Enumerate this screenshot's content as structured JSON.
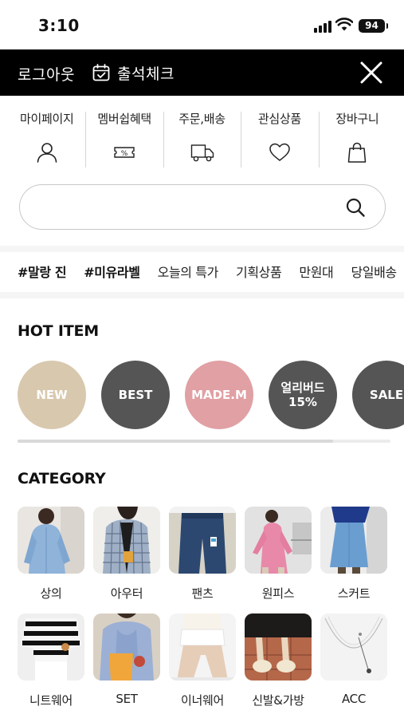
{
  "status": {
    "time": "3:10",
    "battery": "94"
  },
  "topbar": {
    "logout_label": "로그아웃",
    "attendance_label": "출석체크"
  },
  "quickmenu": [
    {
      "label": "마이페이지",
      "icon": "person-icon"
    },
    {
      "label": "멤버쉽혜택",
      "icon": "coupon-icon"
    },
    {
      "label": "주문,배송",
      "icon": "truck-icon"
    },
    {
      "label": "관심상품",
      "icon": "heart-icon"
    },
    {
      "label": "장바구니",
      "icon": "shopping-bag-icon"
    }
  ],
  "search": {
    "placeholder": "",
    "value": ""
  },
  "keywords": [
    {
      "label": "#말랑 진",
      "bold": true
    },
    {
      "label": "#미유라벨",
      "bold": true
    },
    {
      "label": "오늘의 특가",
      "bold": false
    },
    {
      "label": "기획상품",
      "bold": false
    },
    {
      "label": "만원대",
      "bold": false
    },
    {
      "label": "당일배송",
      "bold": false
    }
  ],
  "hot_item": {
    "title": "HOT ITEM",
    "items": [
      {
        "label": "NEW",
        "sub": "",
        "color": "#d8c8ae"
      },
      {
        "label": "BEST",
        "sub": "",
        "color": "#555555"
      },
      {
        "label": "MADE.M",
        "sub": "",
        "color": "#e0a0a4"
      },
      {
        "label": "얼리버드",
        "sub": "15%",
        "color": "#555555"
      },
      {
        "label": "SALE",
        "sub": "",
        "color": "#555555"
      }
    ]
  },
  "category": {
    "title": "CATEGORY",
    "items": [
      {
        "label": "상의"
      },
      {
        "label": "아우터"
      },
      {
        "label": "팬츠"
      },
      {
        "label": "원피스"
      },
      {
        "label": "스커트"
      },
      {
        "label": "니트웨어"
      },
      {
        "label": "SET"
      },
      {
        "label": "이너웨어"
      },
      {
        "label": "신발&가방"
      },
      {
        "label": "ACC"
      }
    ]
  }
}
